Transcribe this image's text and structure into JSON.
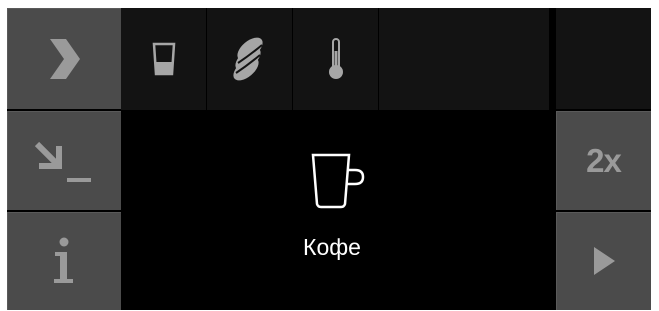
{
  "left_menu": {
    "items": [
      {
        "name": "next",
        "icon": "chevron-right-icon"
      },
      {
        "name": "outlet",
        "icon": "arrow-down-right-icon"
      },
      {
        "name": "info",
        "icon": "info-icon"
      }
    ]
  },
  "top_bar": {
    "slots": [
      {
        "name": "cup-size",
        "icon": "cup-size-icon"
      },
      {
        "name": "bean-strength",
        "icon": "coffee-beans-icon"
      },
      {
        "name": "temperature",
        "icon": "thermometer-icon"
      },
      {
        "name": "empty",
        "icon": ""
      }
    ]
  },
  "center": {
    "beverage_icon": "coffee-cup-icon",
    "beverage_name": "Кофе"
  },
  "right_menu": {
    "double_label": "2x",
    "start_icon": "play-icon"
  },
  "colors": {
    "background": "#000000",
    "side_button": "#4b4b4b",
    "top_slot": "#131313",
    "icon_gray": "#9a9a9a",
    "text": "#ffffff"
  }
}
